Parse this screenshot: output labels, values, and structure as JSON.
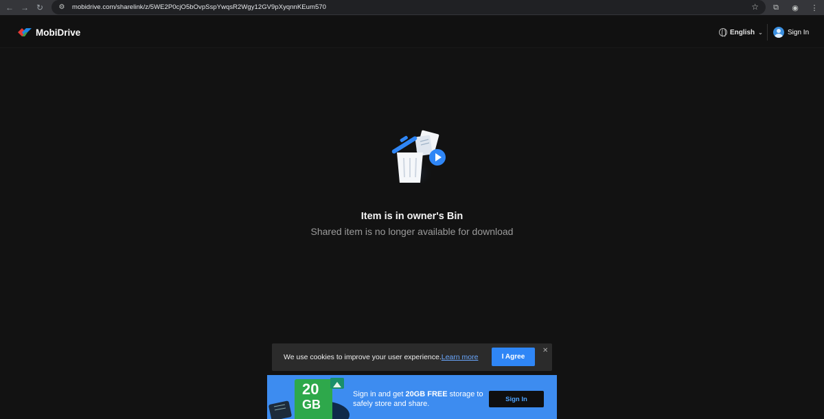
{
  "browser": {
    "url": "mobidrive.com/sharelink/z/5WE2P0cjO5bOvpSspYwqsR2Wgy12GV9pXyqnnKEum570"
  },
  "header": {
    "brand": "MobiDrive",
    "language": "English",
    "sign_in": "Sign In"
  },
  "empty_state": {
    "title": "Item is in owner's Bin",
    "subtitle": "Shared item is no longer available for download"
  },
  "cookie_bar": {
    "text": "We use cookies to improve your user experience.",
    "link": "Learn more",
    "agree_button": "I Agree",
    "close_glyph": "✕"
  },
  "promo": {
    "badge_number": "20",
    "badge_unit": "GB",
    "text_before": "Sign in and get ",
    "text_bold": "20GB FREE",
    "text_after": " storage to safely store and share.",
    "button": "Sign In"
  },
  "colors": {
    "page_bg": "#121212",
    "accent_blue": "#2f86f6",
    "promo_blue": "#3d8cf0",
    "badge_green": "#2ea84b"
  },
  "icons": [
    "back-arrow-icon",
    "forward-arrow-icon",
    "reload-icon",
    "site-info-icon",
    "star-icon",
    "extensions-icon",
    "profile-icon",
    "more-icon",
    "globe-icon",
    "chevron-down-icon",
    "user-avatar-icon",
    "trash-bin-icon",
    "play-icon",
    "close-icon"
  ]
}
